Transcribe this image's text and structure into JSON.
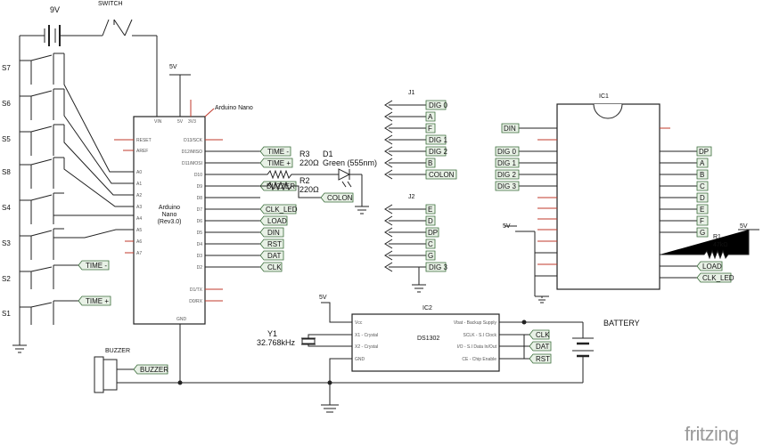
{
  "power": {
    "battery_9v": "9V",
    "switch": "SWITCH",
    "v5_nano": "5V",
    "v5_ic2": "5V",
    "v5_ic1": "5V",
    "v5_r1": "5V"
  },
  "switches": [
    "S7",
    "S6",
    "S5",
    "S8",
    "S4",
    "S3",
    "S2",
    "S1"
  ],
  "nano": {
    "title": "Arduino Nano",
    "name": [
      "Arduino",
      "Nano",
      "(Rev3.0)"
    ],
    "top_pins": [
      "VIN",
      "5V",
      "3V3"
    ],
    "left_pins": [
      "RESET",
      "AREF",
      "A0",
      "A1",
      "A2",
      "A3",
      "A4",
      "A5",
      "A6",
      "A7"
    ],
    "right_pins": [
      "D13/SCK",
      "D12/MISO",
      "D11/MOSI",
      "D10",
      "D9",
      "D8",
      "D7",
      "D6",
      "D5",
      "D4",
      "D3",
      "D2",
      "D1/TX",
      "D0/RX"
    ],
    "bottom_pin": "GND"
  },
  "nano_tags": [
    "TIME -",
    "TIME +",
    "BUZZER",
    "CLK_LED",
    "LOAD",
    "DIN",
    "RST",
    "DAT",
    "CLK"
  ],
  "switch_tags": [
    "TIME -",
    "TIME +"
  ],
  "led": {
    "r3": "R3",
    "r3_val": "220Ω",
    "d1": "D1",
    "d1_val": "Green (555nm)",
    "r2": "R2",
    "r2_val": "220Ω",
    "colon_tag": "COLON"
  },
  "j1": {
    "title": "J1",
    "pins": [
      "DIG 0",
      "A",
      "F",
      "DIG 1",
      "DIG 2",
      "B",
      "COLON"
    ]
  },
  "j2": {
    "title": "J2",
    "pins": [
      "E",
      "D",
      "DP",
      "C",
      "G",
      "DIG 3"
    ]
  },
  "ic1": {
    "title": "IC1",
    "din_tag": "DIN",
    "left_tags": [
      "DIG 0",
      "DIG 1",
      "DIG 2",
      "DIG 3"
    ],
    "right_tags": [
      "DP",
      "A",
      "B",
      "C",
      "D",
      "E",
      "F",
      "G"
    ],
    "r1": "R1",
    "r1_val": "47kΩ",
    "load_tag": "LOAD",
    "clkled_tag": "CLK_LED"
  },
  "ic2": {
    "title": "IC2",
    "chip": "DS1302",
    "left_pins": [
      "Vcc",
      "X1 - Crystal",
      "X2 - Crystal",
      "GND"
    ],
    "right_pins": [
      "Vbat - Backup Supply",
      "SCLK - S.I Clock",
      "I/O - S.I Data In/Out",
      "CE - Chip Enable"
    ],
    "tags": [
      "CLK",
      "DAT",
      "RST"
    ]
  },
  "crystal": {
    "name": "Y1",
    "value": "32.768kHz"
  },
  "battery": "BATTERY",
  "buzzer": {
    "title": "BUZZER",
    "tag": "BUZZER"
  },
  "watermark": "fritzing"
}
